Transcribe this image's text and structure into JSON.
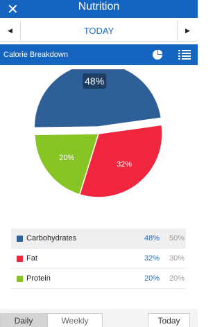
{
  "header": {
    "title": "Nutrition",
    "close_glyph": "✕"
  },
  "date_nav": {
    "prev_glyph": "◀",
    "next_glyph": "▶",
    "label": "TODAY"
  },
  "section": {
    "title": "Calorie Breakdown",
    "icons": [
      "pie-chart-icon",
      "list-icon"
    ]
  },
  "chart_data": {
    "type": "pie",
    "slices": [
      {
        "label": "Carbohydrates",
        "value": 48,
        "color": "#2e5f97",
        "text": "48%"
      },
      {
        "label": "Fat",
        "value": 32,
        "color": "#f0263f",
        "text": "32%"
      },
      {
        "label": "Protein",
        "value": 20,
        "color": "#86c524",
        "text": "20%"
      }
    ]
  },
  "legend": [
    {
      "name": "Carbohydrates",
      "pct": "48%",
      "goal": "50%",
      "color": "#2e5f97"
    },
    {
      "name": "Fat",
      "pct": "32%",
      "goal": "30%",
      "color": "#f0263f"
    },
    {
      "name": "Protein",
      "pct": "20%",
      "goal": "20%",
      "color": "#86c524"
    }
  ],
  "footer": {
    "daily": "Daily",
    "weekly": "Weekly",
    "today": "Today"
  }
}
